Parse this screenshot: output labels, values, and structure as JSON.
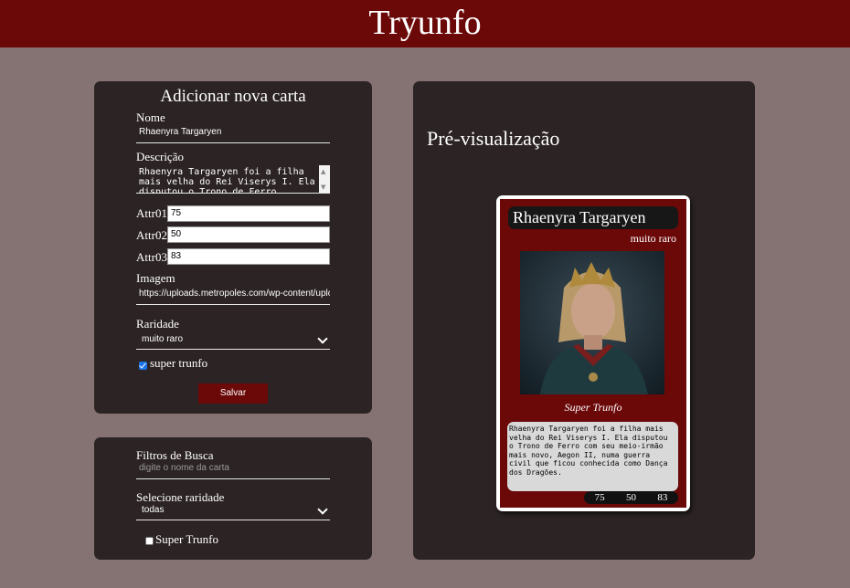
{
  "app": {
    "title": "Tryunfo"
  },
  "form": {
    "title": "Adicionar nova carta",
    "name_label": "Nome",
    "name_value": "Rhaenyra Targaryen",
    "desc_label": "Descrição",
    "desc_value": "Rhaenyra Targaryen foi a filha mais velha do Rei Viserys I. Ela disputou o Trono de Ferro",
    "attr1_label": "Attr01",
    "attr1_value": "75",
    "attr2_label": "Attr02",
    "attr2_value": "50",
    "attr3_label": "Attr03",
    "attr3_value": "83",
    "image_label": "Imagem",
    "image_value": "https://uploads.metropoles.com/wp-content/uploads",
    "rarity_label": "Raridade",
    "rarity_value": "muito raro",
    "super_label": "super trunfo",
    "super_checked": true,
    "save_label": "Salvar"
  },
  "filters": {
    "search_label": "Filtros de Busca",
    "search_placeholder": "digite o nome da carta",
    "rarity_label": "Selecione raridade",
    "rarity_value": "todas",
    "super_label": "Super Trunfo",
    "super_checked": false
  },
  "preview": {
    "title": "Pré-visualização",
    "card": {
      "name": "Rhaenyra Targaryen",
      "rarity": "muito raro",
      "super_label": "Super Trunfo",
      "description": "Rhaenyra Targaryen foi a filha mais velha do Rei Viserys I. Ela disputou o Trono de Ferro com seu meio-irmão mais novo, Aegon II, numa guerra civil que ficou conhecida como Dança dos Dragões.",
      "attr1": "75",
      "attr2": "50",
      "attr3": "83"
    }
  },
  "colors": {
    "header": "#6b0808",
    "background": "#857373",
    "panel": "#2c2424",
    "card_frame": "#6b0808",
    "checkbox_accent": "#1a73e8"
  },
  "icons": {
    "select_arrow": "chevron-down-icon",
    "textarea_scroll": "scroll-arrows-icon"
  }
}
